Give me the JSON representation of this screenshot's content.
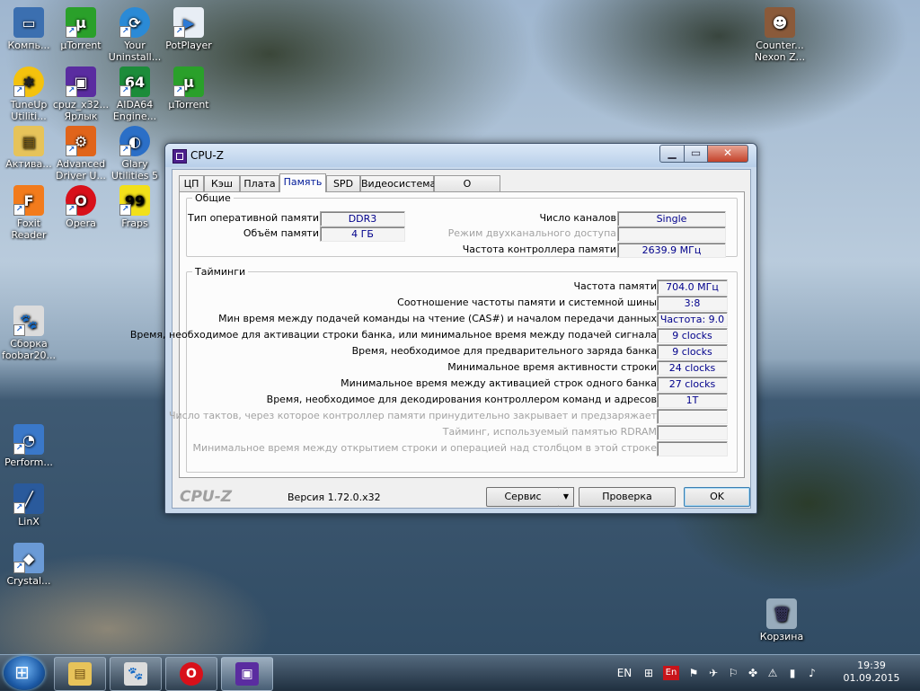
{
  "desktop": {
    "icons": [
      {
        "label": "Компь...",
        "name": "computer"
      },
      {
        "label": "µTorrent",
        "name": "utorrent"
      },
      {
        "label": "Your Uninstall...",
        "name": "your-uninstaller"
      },
      {
        "label": "PotPlayer",
        "name": "potplayer"
      },
      {
        "label": "TuneUp Utiliti...",
        "name": "tuneup"
      },
      {
        "label": "cpuz_x32... Ярлык",
        "name": "cpuz-shortcut"
      },
      {
        "label": "AIDA64 Engine...",
        "name": "aida64"
      },
      {
        "label": "µTorrent",
        "name": "utorrent-2"
      },
      {
        "label": "Актива...",
        "name": "activator"
      },
      {
        "label": "Advanced Driver U...",
        "name": "advanced-driver-updater"
      },
      {
        "label": "Glary Utilities 5",
        "name": "glary"
      },
      {
        "label": "Foxit Reader",
        "name": "foxit"
      },
      {
        "label": "Opera",
        "name": "opera"
      },
      {
        "label": "Fraps",
        "name": "fraps"
      },
      {
        "label": "Сборка foobar20...",
        "name": "foobar"
      },
      {
        "label": "Perform...",
        "name": "performance"
      },
      {
        "label": "LinX",
        "name": "linx"
      },
      {
        "label": "Crystal...",
        "name": "crystal"
      },
      {
        "label": "Counter... Nexon Z...",
        "name": "counter-strike"
      },
      {
        "label": "Корзина",
        "name": "recycle-bin"
      }
    ]
  },
  "window": {
    "title": "CPU-Z",
    "tabs": [
      "ЦП",
      "Кэш",
      "Плата",
      "Память",
      "SPD",
      "Видеосистема",
      "О программе"
    ],
    "active_tab": "Память",
    "general": {
      "legend": "Общие",
      "type_label": "Тип оперативной памяти",
      "type_value": "DDR3",
      "size_label": "Объём памяти",
      "size_value": "4 ГБ",
      "channels_label": "Число каналов",
      "channels_value": "Single",
      "dual_label": "Режим двухканального доступа",
      "dual_value": "",
      "nb_freq_label": "Частота контроллера памяти",
      "nb_freq_value": "2639.9 МГц"
    },
    "timings": {
      "legend": "Тайминги",
      "rows": [
        {
          "label": "Частота памяти",
          "value": "704.0 МГц",
          "enabled": true
        },
        {
          "label": "Соотношение частоты памяти и системной шины",
          "value": "3:8",
          "enabled": true
        },
        {
          "label": "Мин время между подачей команды на чтение (CAS#) и началом передачи данных",
          "value": "Частота: 9.0",
          "enabled": true
        },
        {
          "label": "Время, необходимое для активации строки банка, или минимальное время между подачей сигнала",
          "value": "9 clocks",
          "enabled": true
        },
        {
          "label": "Время, необходимое для предварительного заряда банка",
          "value": "9 clocks",
          "enabled": true
        },
        {
          "label": "Минимальное время активности строки",
          "value": "24 clocks",
          "enabled": true
        },
        {
          "label": "Минимальное время между активацией строк одного банка",
          "value": "27 clocks",
          "enabled": true
        },
        {
          "label": "Время, необходимое для декодирования контроллером команд и адресов",
          "value": "1T",
          "enabled": true
        },
        {
          "label": "Число тактов, через которое контроллер памяти принудительно закрывает и предзаряжает",
          "value": "",
          "enabled": false
        },
        {
          "label": "Тайминг, используемый памятью RDRAM",
          "value": "",
          "enabled": false
        },
        {
          "label": "Минимальное время между открытием строки и операцией над столбцом в этой строке",
          "value": "",
          "enabled": false
        }
      ]
    },
    "footer": {
      "brand": "CPU-Z",
      "version": "Версия 1.72.0.x32",
      "service_button": "Сервис",
      "validate_button": "Проверка",
      "ok_button": "OK"
    }
  },
  "taskbar": {
    "lang": "EN",
    "lang_badge": "En",
    "time": "19:39",
    "date": "01.09.2015"
  }
}
